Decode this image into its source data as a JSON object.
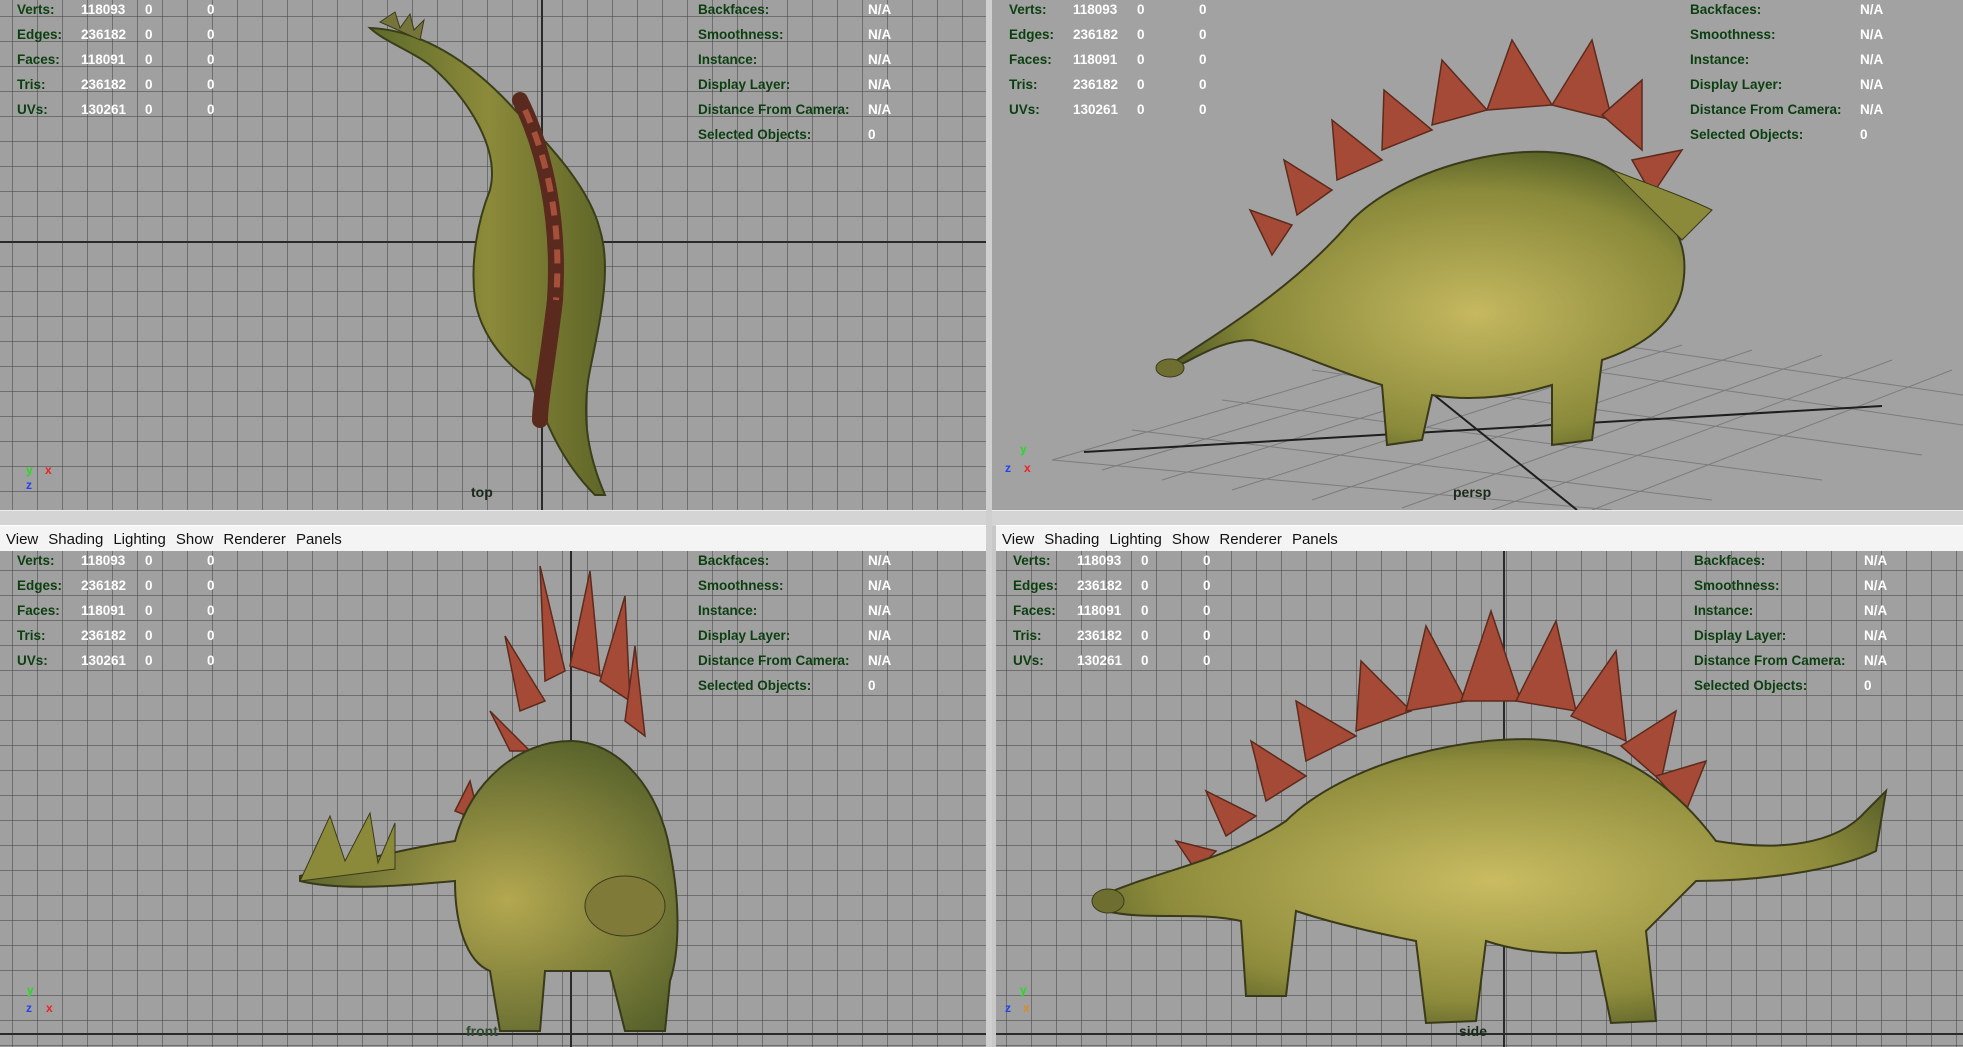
{
  "menu": {
    "items": [
      "View",
      "Shading",
      "Lighting",
      "Show",
      "Renderer",
      "Panels"
    ]
  },
  "hud_left": {
    "rows": [
      {
        "label": "Verts:",
        "v1": "118093",
        "v2": "0",
        "v3": "0"
      },
      {
        "label": "Edges:",
        "v1": "236182",
        "v2": "0",
        "v3": "0"
      },
      {
        "label": "Faces:",
        "v1": "118091",
        "v2": "0",
        "v3": "0"
      },
      {
        "label": "Tris:",
        "v1": "236182",
        "v2": "0",
        "v3": "0"
      },
      {
        "label": "UVs:",
        "v1": "130261",
        "v2": "0",
        "v3": "0"
      }
    ]
  },
  "hud_right": {
    "rows": [
      {
        "label": "Backfaces:",
        "value": "N/A"
      },
      {
        "label": "Smoothness:",
        "value": "N/A"
      },
      {
        "label": "Instance:",
        "value": "N/A"
      },
      {
        "label": "Display Layer:",
        "value": "N/A"
      },
      {
        "label": "Distance From Camera:",
        "value": "N/A"
      },
      {
        "label": "Selected Objects:",
        "value": "0"
      }
    ]
  },
  "viewports": {
    "top": {
      "label": "top",
      "axes": [
        "y",
        "x",
        "z"
      ]
    },
    "persp": {
      "label": "persp",
      "axes": [
        "y",
        "z",
        "x"
      ]
    },
    "front": {
      "label": "front",
      "axes": [
        "y",
        "z",
        "x"
      ]
    },
    "side": {
      "label": "side",
      "axes": [
        "y",
        "z",
        "x"
      ]
    }
  },
  "colors": {
    "viewport_bg": "#a0a0a0",
    "grid_line": "#555555",
    "hud_label": "#0b3f10",
    "hud_value": "#ffffff",
    "axis_x": "#ee2222",
    "axis_y": "#22dd22",
    "axis_z": "#2244ee",
    "model_body": "#8a8a3a",
    "model_plates": "#a44a36"
  }
}
